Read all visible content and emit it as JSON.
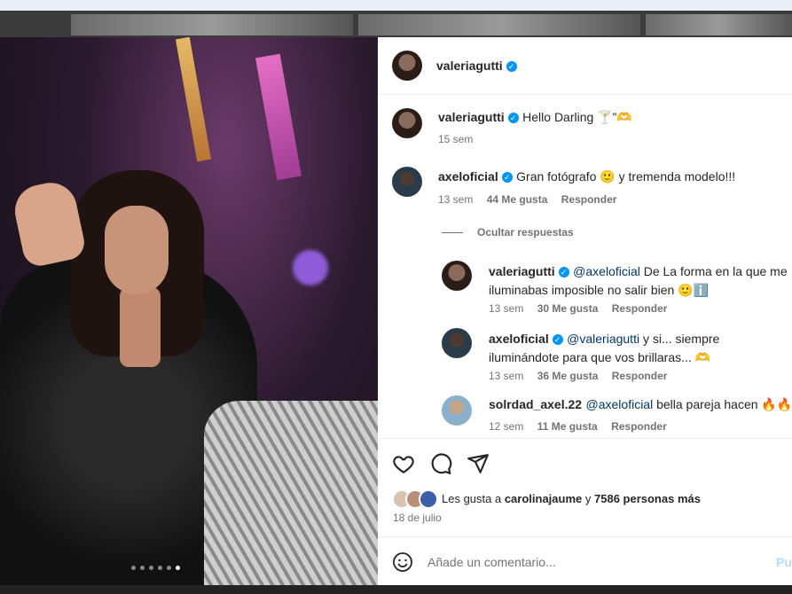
{
  "post": {
    "author": "valeriagutti",
    "caption_text": "Hello Darling 🍸”🫶",
    "caption_time": "15 sem",
    "photo_slide_count": 6,
    "photo_active_slide": 6
  },
  "comments": [
    {
      "user": "axeloficial",
      "text": "Gran fotógrafo 🙂 y tremenda modelo!!!",
      "time": "13 sem",
      "likes": "44 Me gusta",
      "reply": "Responder"
    }
  ],
  "hide_replies": "Ocultar respuestas",
  "replies": [
    {
      "user": "valeriagutti",
      "mention": "@axeloficial",
      "text": " De La forma en la que me",
      "text2": "iluminabas imposible no salir bien 🙂ℹ️",
      "time": "13 sem",
      "likes": "30 Me gusta",
      "reply": "Responder"
    },
    {
      "user": "axeloficial",
      "mention": "@valeriagutti",
      "text": " y si... siempre",
      "text2": "iluminándote para que vos brillaras... 🫶",
      "time": "13 sem",
      "likes": "36 Me gusta",
      "reply": "Responder"
    },
    {
      "user": "solrdad_axel.22",
      "mention": "@axeloficial",
      "text": " bella pareja hacen 🔥🔥",
      "time": "12 sem",
      "likes": "11 Me gusta",
      "reply": "Responder"
    }
  ],
  "actions": {
    "like_icon": "heart-icon",
    "comment_icon": "comment-icon",
    "share_icon": "send-icon"
  },
  "likes_summary": {
    "prefix": "Les gusta a ",
    "user": "carolinajaume",
    "mid": " y ",
    "count": "7586 personas más"
  },
  "post_date": "18 de julio",
  "comment_box": {
    "placeholder": "Añade un comentario...",
    "submit": "Pu"
  },
  "colors": {
    "accent": "#0095f6",
    "mention": "#00376b",
    "muted": "#737373"
  }
}
